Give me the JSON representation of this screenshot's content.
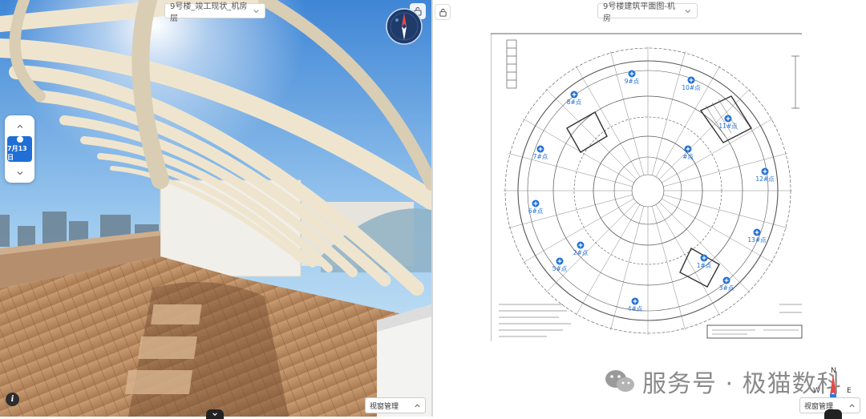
{
  "left_panel": {
    "scene_dropdown": "9号楼_竣工现状_机房层",
    "date_nav": {
      "selected_date": "7月13日"
    },
    "view_management": "视窗管理"
  },
  "right_panel": {
    "drawing_dropdown": "9号楼建筑平面图-机房",
    "view_management": "视窗管理",
    "compass_labels": {
      "north": "N",
      "west": "W",
      "east": "E"
    },
    "camera_points": [
      {
        "label": "9#点"
      },
      {
        "label": "10#点"
      },
      {
        "label": "8#点"
      },
      {
        "label": "11#点"
      },
      {
        "label": "7#点"
      },
      {
        "label": "#点"
      },
      {
        "label": "12#点"
      },
      {
        "label": "6#点"
      },
      {
        "label": "13#点"
      },
      {
        "label": "2#点"
      },
      {
        "label": "1#点"
      },
      {
        "label": "5#点"
      },
      {
        "label": "3#点"
      },
      {
        "label": "4#点"
      }
    ]
  },
  "watermark": {
    "text": "服务号 · 极猫数科"
  },
  "colors": {
    "accent": "#1f6fd6",
    "sky": "#7fb6e8",
    "deck": "#b5835a"
  }
}
